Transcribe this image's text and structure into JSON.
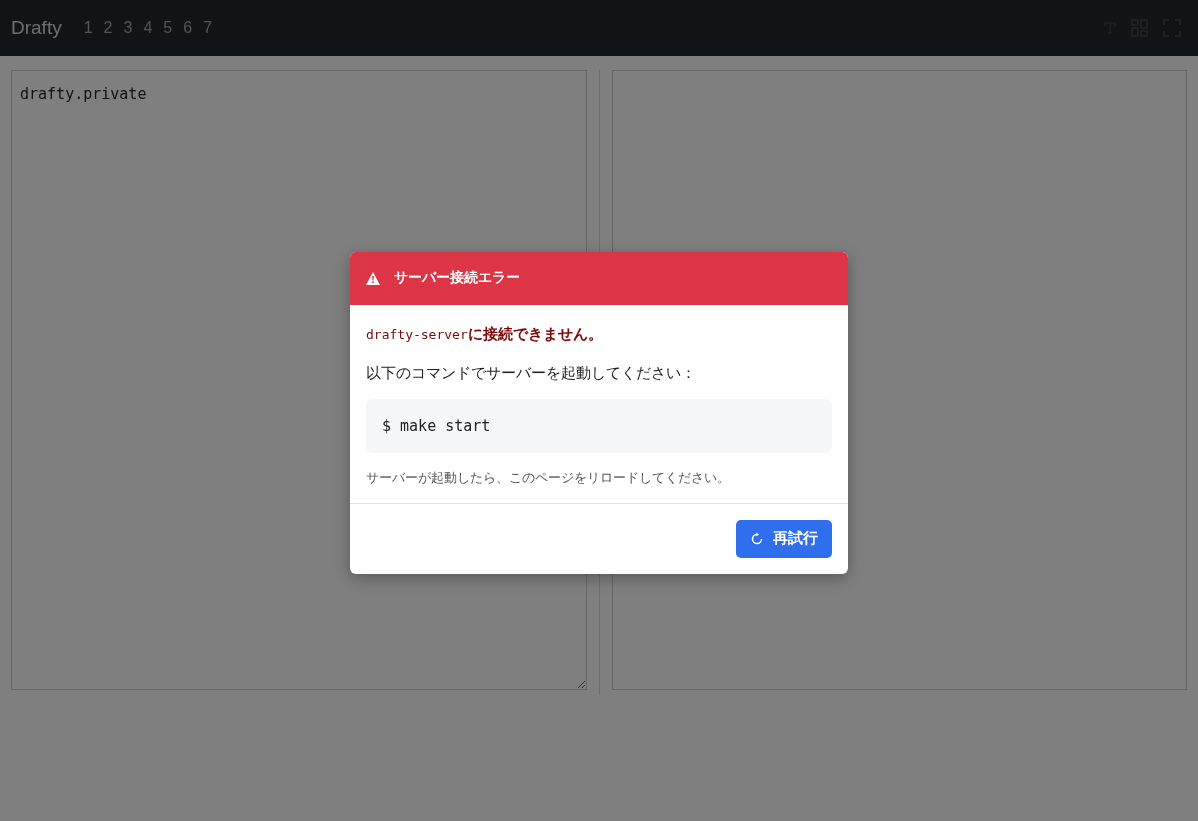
{
  "app": {
    "title": "Drafty",
    "pages": [
      "1",
      "2",
      "3",
      "4",
      "5",
      "6",
      "7"
    ]
  },
  "editor": {
    "value": "drafty.private"
  },
  "dialog": {
    "title": "サーバー接続エラー",
    "server": "drafty-server",
    "error": "に接続できません。",
    "instruction": "以下のコマンドでサーバーを起動してください：",
    "command": "$ make start",
    "note": "サーバーが起動したら、このページをリロードしてください。",
    "button": "再試行"
  }
}
